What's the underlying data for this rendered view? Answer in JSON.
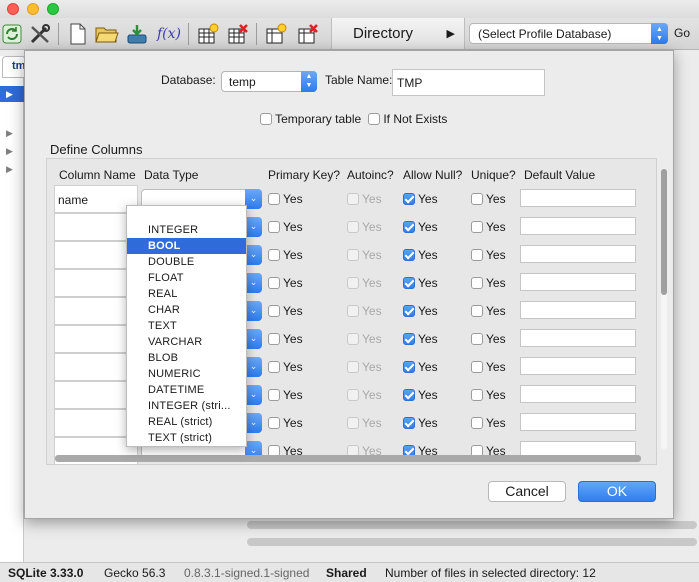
{
  "toolbar": {
    "directory_label": "Directory",
    "profile_select": "(Select Profile Database)",
    "go_label": "Go",
    "fx_label": "f(x)"
  },
  "background": {
    "tab_label": "tm"
  },
  "dialog": {
    "database_label": "Database:",
    "database_value": "temp",
    "table_name_label": "Table Name:",
    "table_name_value": "TMP",
    "temporary_label": "Temporary table",
    "if_not_exists_label": "If Not Exists",
    "define_columns_title": "Define Columns",
    "headers": {
      "column_name": "Column Name",
      "data_type": "Data Type",
      "primary_key": "Primary Key?",
      "autoinc": "Autoinc?",
      "allow_null": "Allow Null?",
      "unique": "Unique?",
      "default_value": "Default Value"
    },
    "yes": "Yes",
    "first_column_name": "name",
    "data_types": [
      "INTEGER",
      "BOOL",
      "DOUBLE",
      "FLOAT",
      "REAL",
      "CHAR",
      "TEXT",
      "VARCHAR",
      "BLOB",
      "NUMERIC",
      "DATETIME",
      "INTEGER (stri...",
      "REAL (strict)",
      "TEXT (strict)"
    ],
    "selected_data_type": "BOOL",
    "cancel_label": "Cancel",
    "ok_label": "OK"
  },
  "status": {
    "sqlite": "SQLite 3.33.0",
    "gecko": "Gecko 56.3",
    "version": "0.8.3.1-signed.1-signed",
    "shared": "Shared",
    "files": "Number of files in selected directory: 12"
  },
  "colors": {
    "accent": "#2f6bd9",
    "ok_button": "#2f7ff0"
  }
}
